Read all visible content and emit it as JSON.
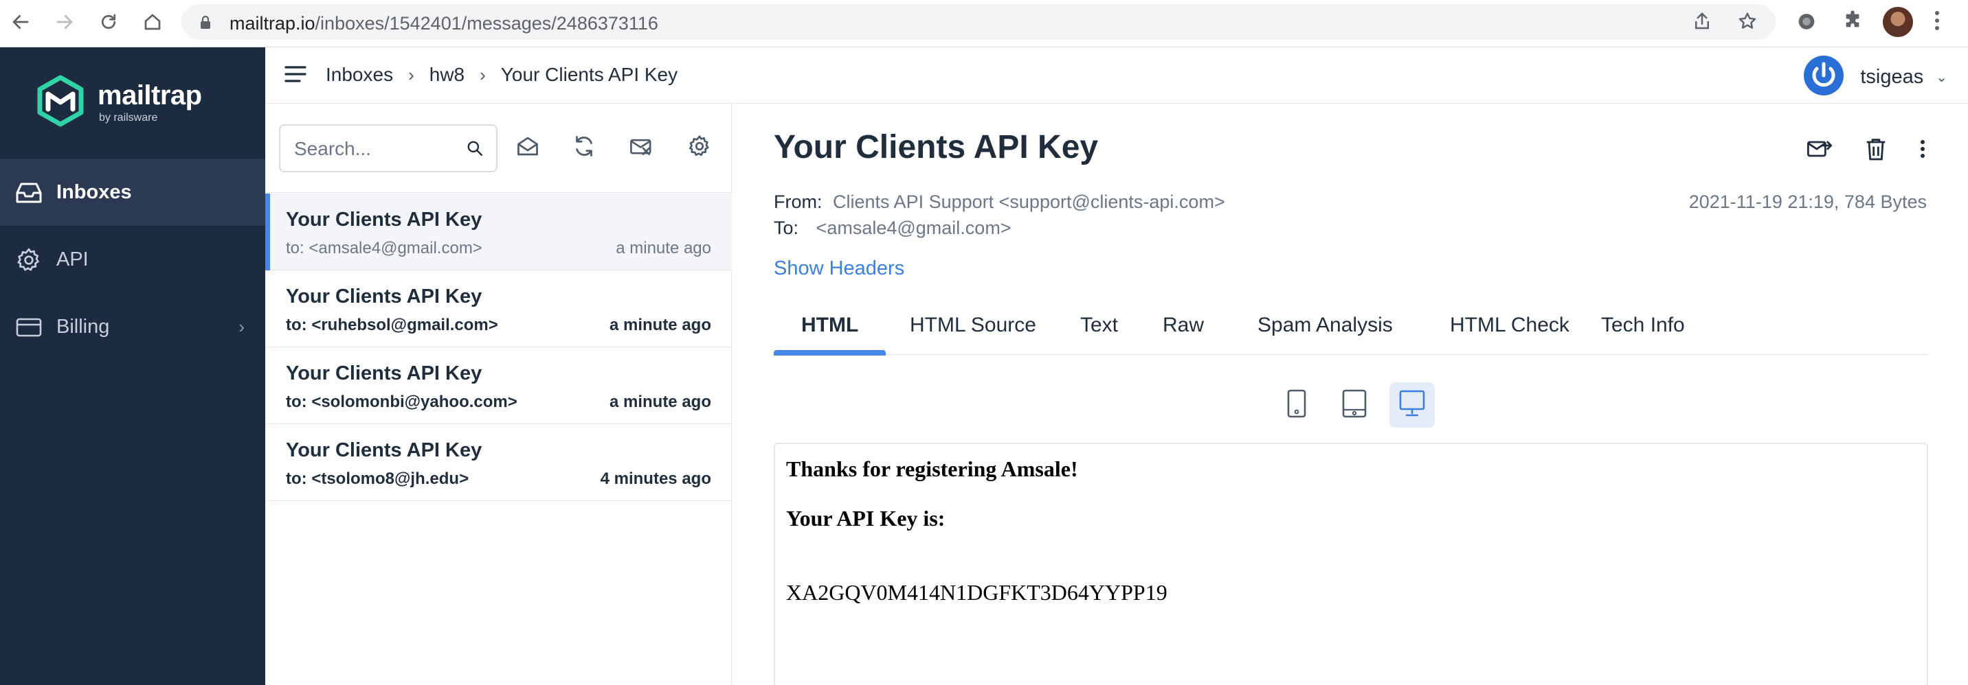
{
  "browser": {
    "url_host": "mailtrap.io",
    "url_path": "/inboxes/1542401/messages/2486373116"
  },
  "sidebar": {
    "logo_text": "mailtrap",
    "logo_sub": "by railsware",
    "items": [
      {
        "label": "Inboxes",
        "icon": "inbox-icon"
      },
      {
        "label": "API",
        "icon": "gear-icon"
      },
      {
        "label": "Billing",
        "icon": "card-icon"
      }
    ]
  },
  "header": {
    "breadcrumb": [
      "Inboxes",
      "hw8",
      "Your Clients API Key"
    ],
    "user": "tsigeas"
  },
  "list": {
    "search_placeholder": "Search...",
    "messages": [
      {
        "subject": "Your Clients API Key",
        "to": "to: <amsale4@gmail.com>",
        "time": "a minute ago"
      },
      {
        "subject": "Your Clients API Key",
        "to": "to: <ruhebsol@gmail.com>",
        "time": "a minute ago"
      },
      {
        "subject": "Your Clients API Key",
        "to": "to: <solomonbi@yahoo.com>",
        "time": "a minute ago"
      },
      {
        "subject": "Your Clients API Key",
        "to": "to: <tsolomo8@jh.edu>",
        "time": "4 minutes ago"
      }
    ]
  },
  "message": {
    "title": "Your Clients API Key",
    "from_label": "From:",
    "from_value": "Clients API Support <support@clients-api.com>",
    "to_label": "To:",
    "to_value": "<amsale4@gmail.com>",
    "date_size": "2021-11-19 21:19, 784 Bytes",
    "show_headers": "Show Headers",
    "tabs": [
      "HTML",
      "HTML Source",
      "Text",
      "Raw",
      "Spam Analysis",
      "HTML Check",
      "Tech Info"
    ],
    "body": {
      "line1": "Thanks for registering Amsale!",
      "line2": "Your API Key is:",
      "key": "XA2GQV0M414N1DGFKT3D64YYPP19"
    }
  },
  "colors": {
    "sidebar_bg": "#1d2b40",
    "accent": "#4a86e8",
    "link": "#3b7fe0"
  }
}
